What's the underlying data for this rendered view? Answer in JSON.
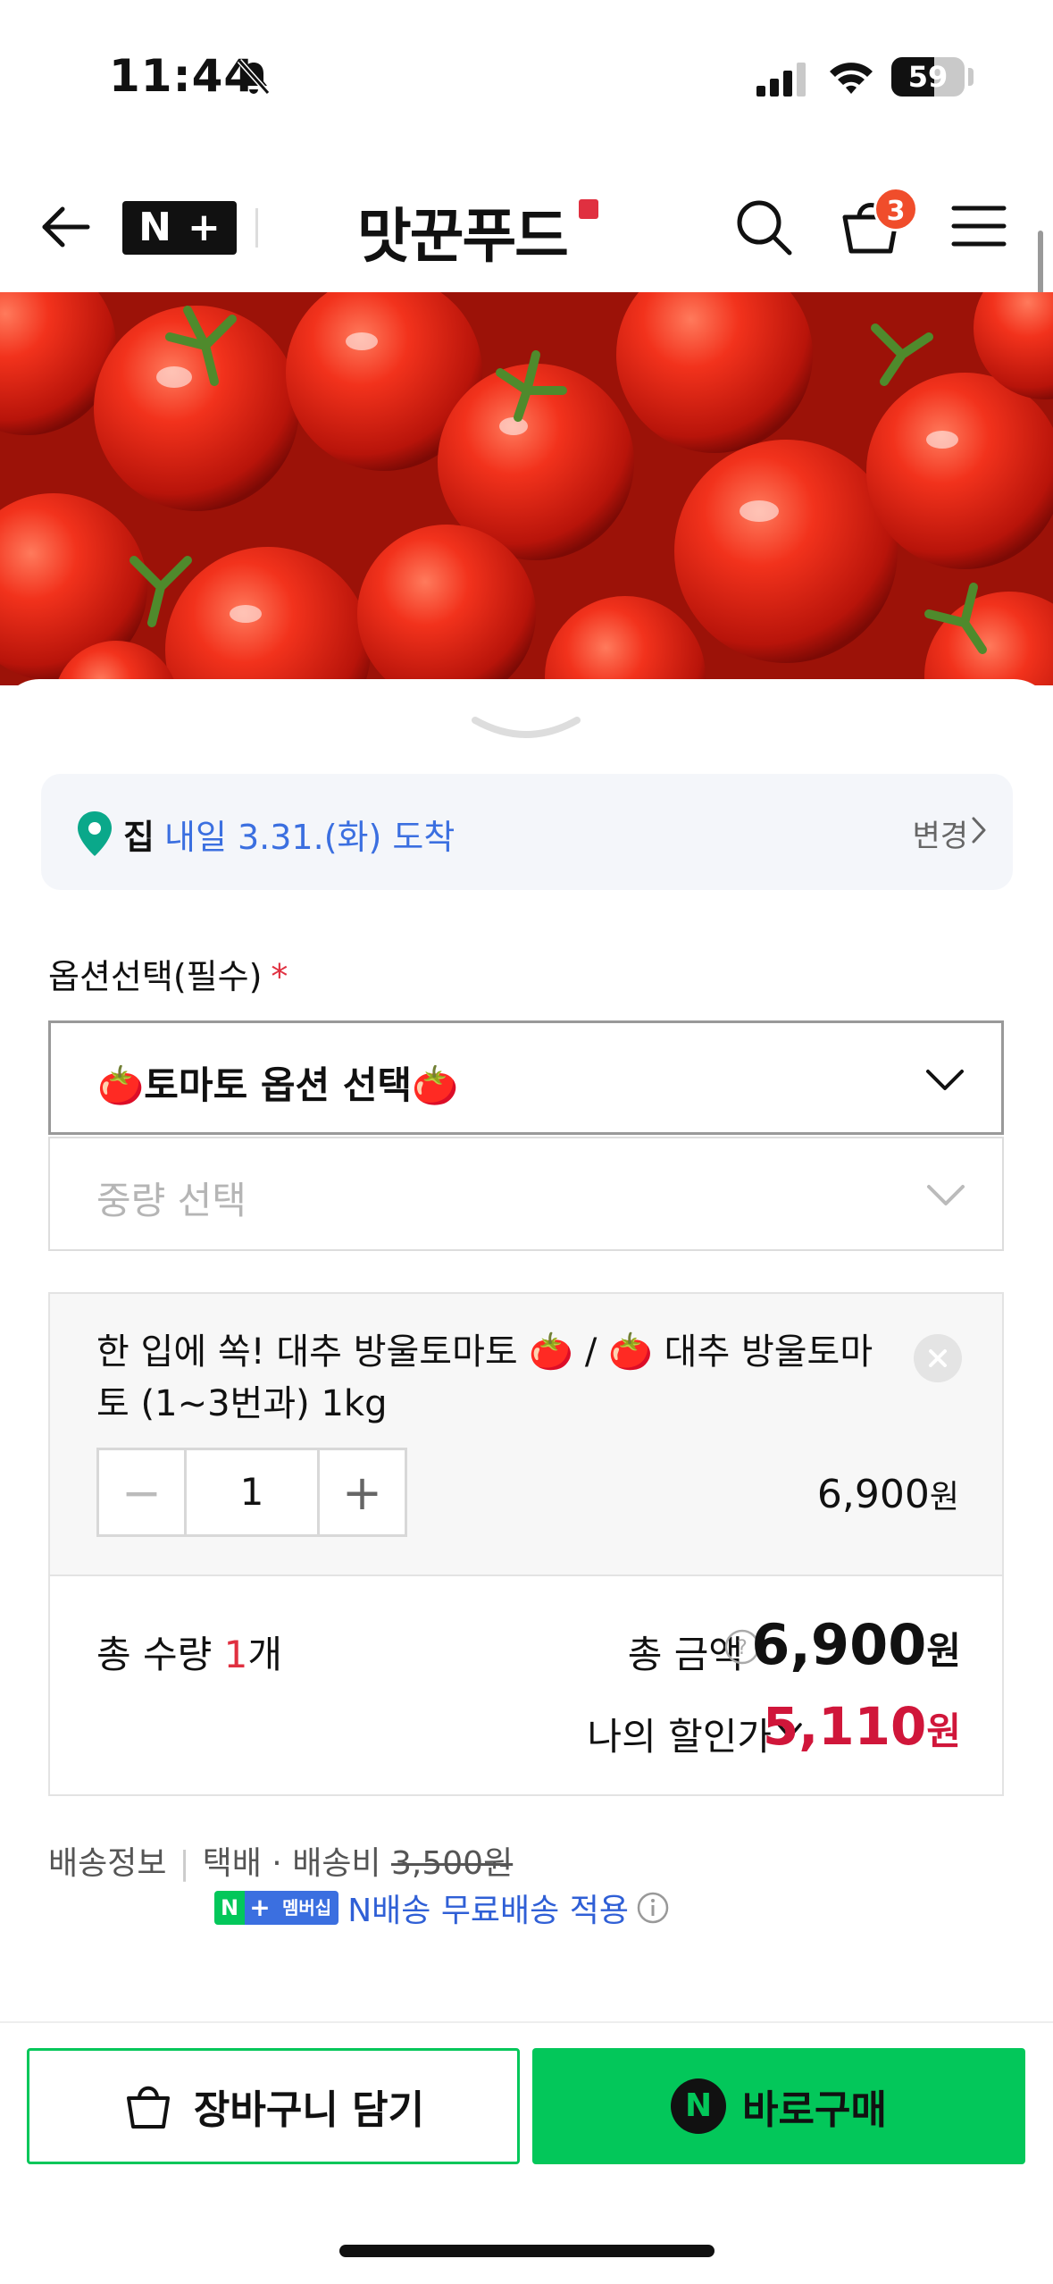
{
  "status_bar": {
    "time": "11:44",
    "battery": "59",
    "battery_level": 0.59
  },
  "header": {
    "nplus_n": "N",
    "nplus_plus": "+",
    "store_name": "맛꾼푸드",
    "cart_count": "3"
  },
  "delivery": {
    "home_label": "집",
    "arrival_text": "내일 3.31.(화) 도착",
    "change_label": "변경"
  },
  "options": {
    "title": "옵션선택(필수)",
    "required_mark": "*",
    "select1_value": "🍅토마토 옵션 선택🍅",
    "select2_placeholder": "중량 선택"
  },
  "selected_item": {
    "name": "한 입에 쏙! 대추 방울토마토 🍅 / 🍅 대추 방울토마토 (1~3번과) 1kg",
    "minus_label": "−",
    "quantity": "1",
    "plus_label": "+",
    "price": "6,900",
    "currency": "원"
  },
  "totals": {
    "qty_prefix": "총 수량 ",
    "qty_value": "1",
    "qty_suffix": "개",
    "amount_label": "총 금액",
    "amount": "6,900",
    "currency": "원",
    "discount_label": "나의 할인가",
    "discount_amount": "5,110"
  },
  "shipping": {
    "label": "배송정보",
    "method": "택배 · 배송비",
    "fee": "3,500원",
    "badge_n": "N",
    "badge_plus": "+",
    "badge_text": "멤버십",
    "free_text": "N배송 무료배송 적용"
  },
  "actions": {
    "cart_label": "장바구니 담기",
    "buy_icon_letter": "N",
    "buy_label": "바로구매"
  },
  "colors": {
    "naver_green": "#03c75a",
    "accent_blue": "#3b6fe0",
    "discount_red": "#d0163a",
    "badge_orange": "#f04d2b"
  },
  "icons": [
    "bell-slash-icon",
    "signal-icon",
    "wifi-icon",
    "back-arrow-icon",
    "search-icon",
    "shopping-bag-icon",
    "menu-icon",
    "location-pin-icon",
    "chevron-right-icon",
    "chevron-down-icon",
    "close-icon",
    "help-icon",
    "info-icon"
  ]
}
